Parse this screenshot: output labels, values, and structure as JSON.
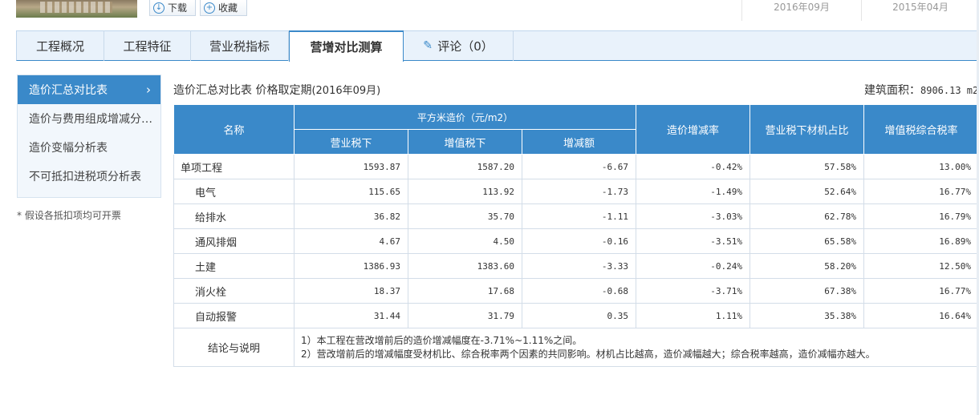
{
  "top": {
    "download_label": "下载",
    "favorite_label": "收藏",
    "dates": [
      "2016年09月",
      "2015年04月"
    ]
  },
  "tabs": [
    {
      "label": "工程概况"
    },
    {
      "label": "工程特征"
    },
    {
      "label": "营业税指标"
    },
    {
      "label": "营增对比测算"
    },
    {
      "label": "评论（0）"
    }
  ],
  "sidebar": {
    "items": [
      {
        "label": "造价汇总对比表"
      },
      {
        "label": "造价与费用组成增减分…"
      },
      {
        "label": "造价变幅分析表"
      },
      {
        "label": "不可抵扣进税项分析表"
      }
    ],
    "note": "* 假设各抵扣项均可开票"
  },
  "main": {
    "title": "造价汇总对比表 价格取定期",
    "title_period": "(2016年09月)",
    "area_label": "建筑面积：",
    "area_value": "8906.13 m2"
  },
  "table": {
    "headers": {
      "name": "名称",
      "unit_price": "平方米造价（元/m2）",
      "before": "营业税下",
      "after": "增值税下",
      "diff": "增减额",
      "rate": "造价增减率",
      "material_ratio": "营业税下材机占比",
      "tax_rate": "增值税综合税率"
    },
    "rows": [
      {
        "name": "单项工程",
        "before": "1593.87",
        "after": "1587.20",
        "diff": "-6.67",
        "rate": "-0.42%",
        "material_ratio": "57.58%",
        "tax_rate": "13.00%"
      },
      {
        "name": "电气",
        "before": "115.65",
        "after": "113.92",
        "diff": "-1.73",
        "rate": "-1.49%",
        "material_ratio": "52.64%",
        "tax_rate": "16.77%"
      },
      {
        "name": "给排水",
        "before": "36.82",
        "after": "35.70",
        "diff": "-1.11",
        "rate": "-3.03%",
        "material_ratio": "62.78%",
        "tax_rate": "16.79%"
      },
      {
        "name": "通风排烟",
        "before": "4.67",
        "after": "4.50",
        "diff": "-0.16",
        "rate": "-3.51%",
        "material_ratio": "65.58%",
        "tax_rate": "16.89%"
      },
      {
        "name": "土建",
        "before": "1386.93",
        "after": "1383.60",
        "diff": "-3.33",
        "rate": "-0.24%",
        "material_ratio": "58.20%",
        "tax_rate": "12.50%"
      },
      {
        "name": "消火栓",
        "before": "18.37",
        "after": "17.68",
        "diff": "-0.68",
        "rate": "-3.71%",
        "material_ratio": "67.38%",
        "tax_rate": "16.77%"
      },
      {
        "name": "自动报警",
        "before": "31.44",
        "after": "31.79",
        "diff": "0.35",
        "rate": "1.11%",
        "material_ratio": "35.38%",
        "tax_rate": "16.64%"
      }
    ],
    "conclusion_label": "结论与说明",
    "conclusion_lines": [
      "1）本工程在营改增前后的造价增减幅度在-3.71%~1.11%之间。",
      "2）营改增前后的增减幅度受材机比、综合税率两个因素的共同影响。材机占比越高，造价减幅越大；综合税率越高，造价减幅亦越大。"
    ]
  },
  "colors": {
    "accent": "#3a89c9",
    "tab_bar_bg": "#e9f2fb",
    "sidebar_bg": "#f2f7fc"
  }
}
